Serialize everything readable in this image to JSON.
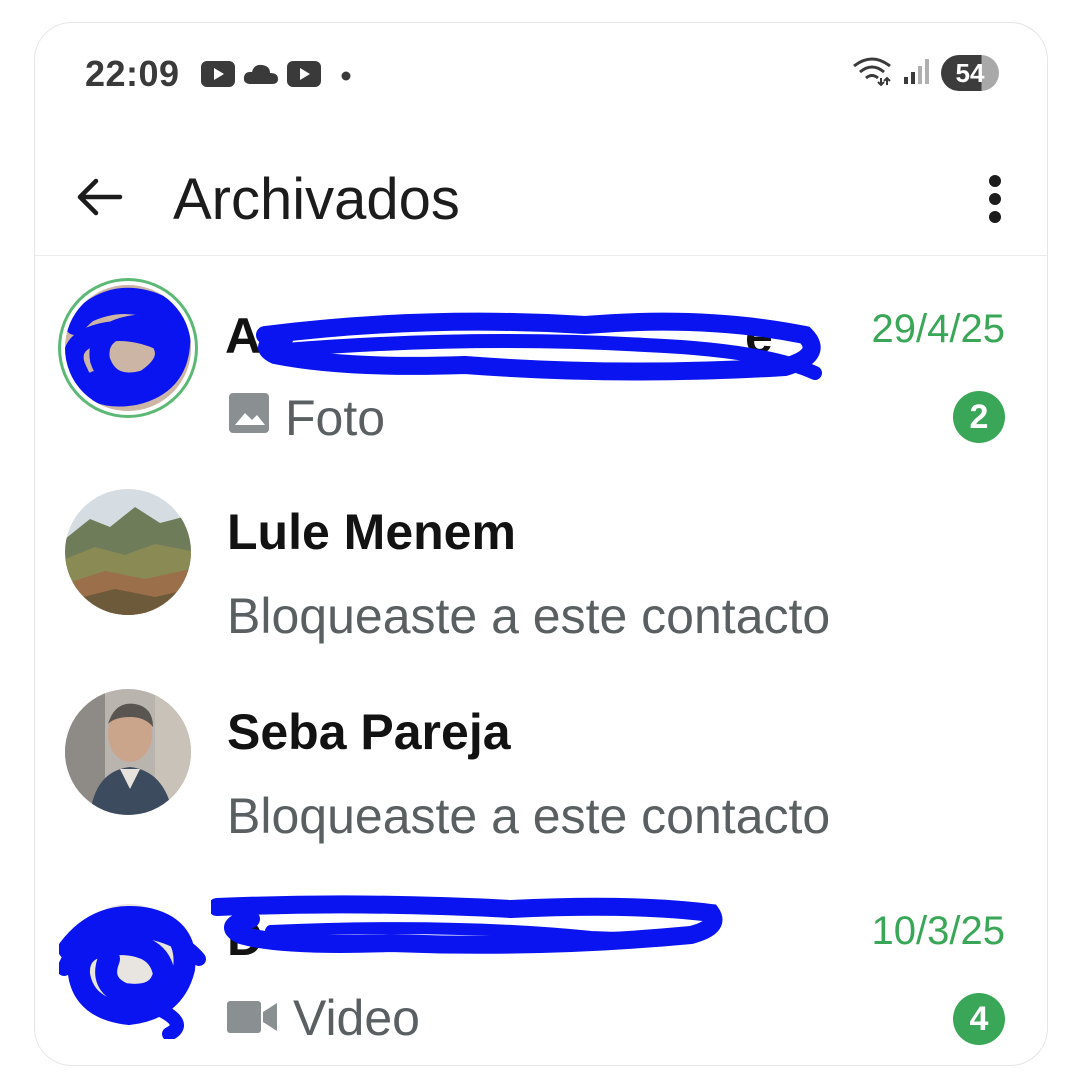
{
  "status_bar": {
    "time": "22:09",
    "battery": "54",
    "left_icons": [
      "youtube-icon",
      "cloud-icon",
      "youtube-icon",
      "dot-icon"
    ],
    "right_icons": [
      "wifi-icon",
      "signal-icon"
    ]
  },
  "app_bar": {
    "title": "Archivados",
    "back_icon": "arrow-left-icon",
    "menu_icon": "more-vert-icon"
  },
  "colors": {
    "accent": "#3aa657",
    "redaction": "#0a14f0",
    "preview_text": "#5a5f62"
  },
  "chats": [
    {
      "name": "",
      "name_redacted": true,
      "preview": "Foto",
      "preview_icon": "photo-icon",
      "time": "29/4/25",
      "unread": "2",
      "avatar_redacted": true,
      "has_status_ring": true
    },
    {
      "name": "Lule Menem",
      "preview": "Bloqueaste a este contacto",
      "avatar": "mountain-landscape-photo"
    },
    {
      "name": "Seba Pareja",
      "preview": "Bloqueaste a este contacto",
      "avatar": "man-portrait-photo"
    },
    {
      "name": "",
      "name_redacted": true,
      "preview": "Video",
      "preview_icon": "video-camera-icon",
      "time": "10/3/25",
      "unread": "4",
      "avatar_redacted": true
    }
  ]
}
